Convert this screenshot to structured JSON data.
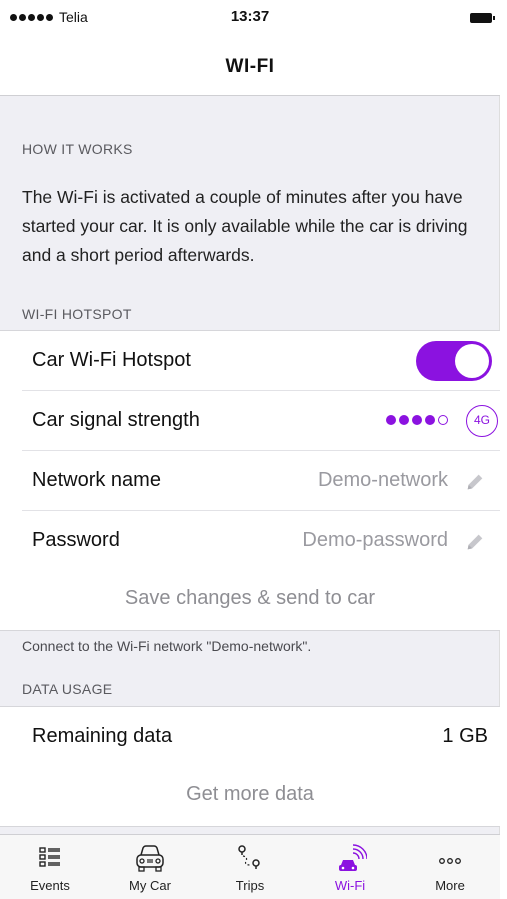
{
  "status_bar": {
    "carrier": "Telia",
    "time": "13:37"
  },
  "nav": {
    "title": "WI-FI"
  },
  "how_it_works": {
    "heading": "HOW IT WORKS",
    "text": "The Wi-Fi is activated a couple of minutes after you have started your car. It is only available while the car is driving and a short period afterwards."
  },
  "hotspot": {
    "heading": "WI-FI HOTSPOT",
    "toggle_label": "Car Wi-Fi Hotspot",
    "toggle_on": true,
    "signal_label": "Car signal strength",
    "signal_level": 4,
    "signal_max": 5,
    "network_badge": "4G",
    "network_name_label": "Network name",
    "network_name_value": "Demo-network",
    "password_label": "Password",
    "password_value": "Demo-password",
    "save_label": "Save changes & send to car",
    "footnote": "Connect to the Wi-Fi network \"Demo-network\"."
  },
  "data_usage": {
    "heading": "DATA USAGE",
    "remaining_label": "Remaining data",
    "remaining_value": "1 GB",
    "get_more_label": "Get more data"
  },
  "tabs": [
    {
      "label": "Events",
      "icon": "list-icon"
    },
    {
      "label": "My Car",
      "icon": "car-icon"
    },
    {
      "label": "Trips",
      "icon": "route-icon"
    },
    {
      "label": "Wi-Fi",
      "icon": "car-wifi-icon",
      "active": true
    },
    {
      "label": "More",
      "icon": "more-icon"
    }
  ],
  "colors": {
    "accent": "#8b12e0",
    "background": "#efeff4"
  }
}
